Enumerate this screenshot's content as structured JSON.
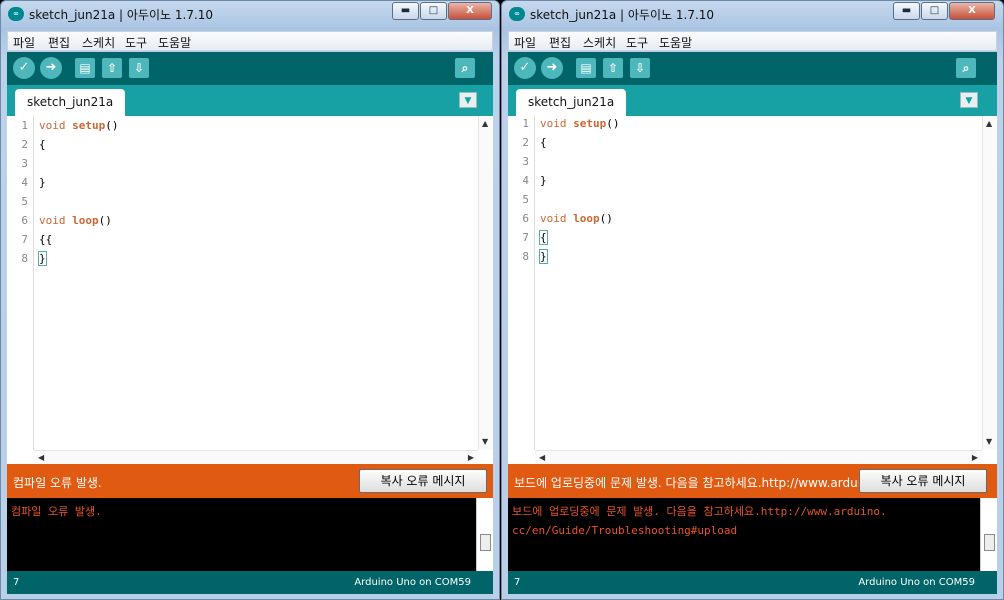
{
  "windows": [
    {
      "title": "sketch_jun21a | 아두이노 1.7.10",
      "app_icon": "∞",
      "controls": {
        "minimize": "▬",
        "maximize": "□",
        "close": "X"
      },
      "menu": [
        "파일",
        "편집",
        "스케치",
        "도구",
        "도움말"
      ],
      "toolbar_icons": [
        "verify-icon",
        "upload-icon",
        "new-icon",
        "open-icon",
        "save-icon",
        "serial-monitor-icon"
      ],
      "tab": "sketch_jun21a",
      "lines": [
        "1",
        "2",
        "3",
        "4",
        "5",
        "6",
        "7",
        "8"
      ],
      "code": {
        "l1_kw": "void",
        "l1_fn": "setup",
        "l1_rest": "()",
        "l2": "{",
        "l4": "}",
        "l6_kw": "void",
        "l6_fn": "loop",
        "l6_rest": "()",
        "l7": "{{",
        "l8": "}"
      },
      "status_message": "컴파일 오류 발생.",
      "copy_button": "복사 오류 메시지",
      "console": [
        "컴파일 오류 발생."
      ],
      "footer_line": "7",
      "footer_board": "Arduino Uno on COM59"
    },
    {
      "title": "sketch_jun21a | 아두이노 1.7.10",
      "app_icon": "∞",
      "controls": {
        "minimize": "▬",
        "maximize": "□",
        "close": "X"
      },
      "menu": [
        "파일",
        "편집",
        "스케치",
        "도구",
        "도움말"
      ],
      "toolbar_icons": [
        "verify-icon",
        "upload-icon",
        "new-icon",
        "open-icon",
        "save-icon",
        "serial-monitor-icon"
      ],
      "tab": "sketch_jun21a",
      "lines": [
        "1",
        "2",
        "3",
        "4",
        "5",
        "6",
        "7",
        "8"
      ],
      "code": {
        "l1_kw": "void",
        "l1_fn": "setup",
        "l1_rest": "()",
        "l2": "{",
        "l4": "}",
        "l6_kw": "void",
        "l6_fn": "loop",
        "l6_rest": "()",
        "l7": "{",
        "l8": "}"
      },
      "status_message": "보드에 업로딩중에 문제 발생. 다음을 참고하세요.http://www.arduino.cc/en/Guide/Troubleshooting#upload",
      "copy_button": "복사 오류 메시지",
      "console": [
        "보드에 업로딩중에 문제 발생. 다음을  참고하세요.http://www.arduino.",
        "cc/en/Guide/Troubleshooting#upload"
      ],
      "footer_line": "7",
      "footer_board": "Arduino Uno on COM59"
    }
  ],
  "colors": {
    "toolbar": "#006468",
    "tab_row": "#17a1a5",
    "status_error": "#e05a12",
    "console_text": "#e8532b",
    "keyword": "#cc6633"
  }
}
